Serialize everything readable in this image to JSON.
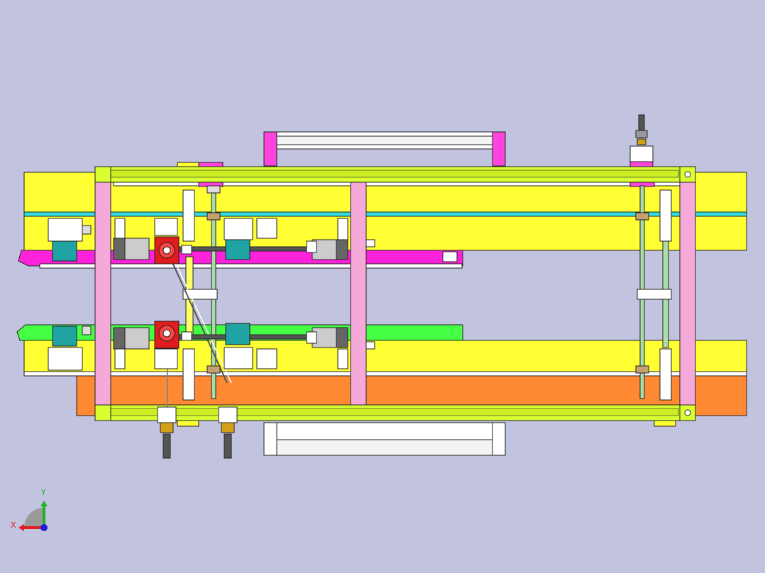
{
  "viewport": {
    "background": "#c1c3df"
  },
  "triad": {
    "x_label": "X",
    "y_label": "Y",
    "x_color": "#e02020",
    "y_color": "#1fb31f",
    "z_color": "#2020d0"
  },
  "colors": {
    "yellow": "#ffff33",
    "lime_frame": "#d9ff33",
    "pink_post": "#f5a9d9",
    "magenta": "#ff22dd",
    "green_rail": "#44ff44",
    "orange": "#ff8833",
    "cyan_line": "#33dddd",
    "gearbox_red": "#e01c1c",
    "teal_block": "#1fa3a3",
    "outline": "#222222"
  }
}
